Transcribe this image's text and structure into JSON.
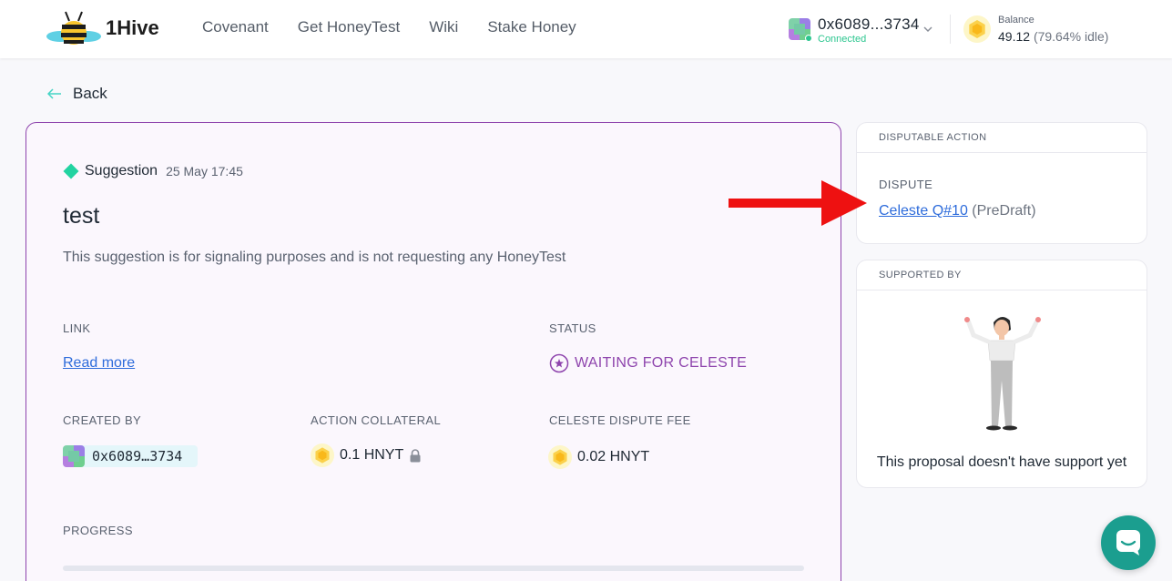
{
  "header": {
    "brand": "1Hive",
    "nav": [
      "Covenant",
      "Get HoneyTest",
      "Wiki",
      "Stake Honey"
    ],
    "account": {
      "address": "0x6089...3734",
      "status": "Connected"
    },
    "balance": {
      "label": "Balance",
      "value": "49.12",
      "idle": "(79.64% idle)"
    }
  },
  "back_label": "Back",
  "proposal": {
    "type": "Suggestion",
    "date": "25 May 17:45",
    "title": "test",
    "description": "This suggestion is for signaling purposes and is not requesting any HoneyTest",
    "link_label": "LINK",
    "link_text": "Read more",
    "status_label": "STATUS",
    "status_value": "WAITING FOR CELESTE",
    "created_by_label": "CREATED BY",
    "creator_address": "0x6089…3734",
    "collateral_label": "ACTION COLLATERAL",
    "collateral_value": "0.1 HNYT",
    "fee_label": "CELESTE DISPUTE FEE",
    "fee_value": "0.02 HNYT",
    "progress_label": "PROGRESS"
  },
  "dispute_card": {
    "header": "DISPUTABLE ACTION",
    "label": "DISPUTE",
    "link_text": "Celeste Q#10",
    "state": "(PreDraft)"
  },
  "support_card": {
    "header": "SUPPORTED BY",
    "empty_text": "This proposal doesn't have support yet"
  },
  "colors": {
    "accent_purple": "#8e44ad",
    "link_blue": "#2e6cdb",
    "connected_green": "#2cc68f",
    "chat_teal": "#1b9e8f",
    "annotation_red": "#ee1111"
  },
  "icons": [
    "bee-logo-icon",
    "chevron-down-icon",
    "honey-coin-icon",
    "back-arrow-icon",
    "diamond-icon",
    "status-star-icon",
    "lock-icon",
    "chat-icon",
    "red-arrow-annotation"
  ]
}
